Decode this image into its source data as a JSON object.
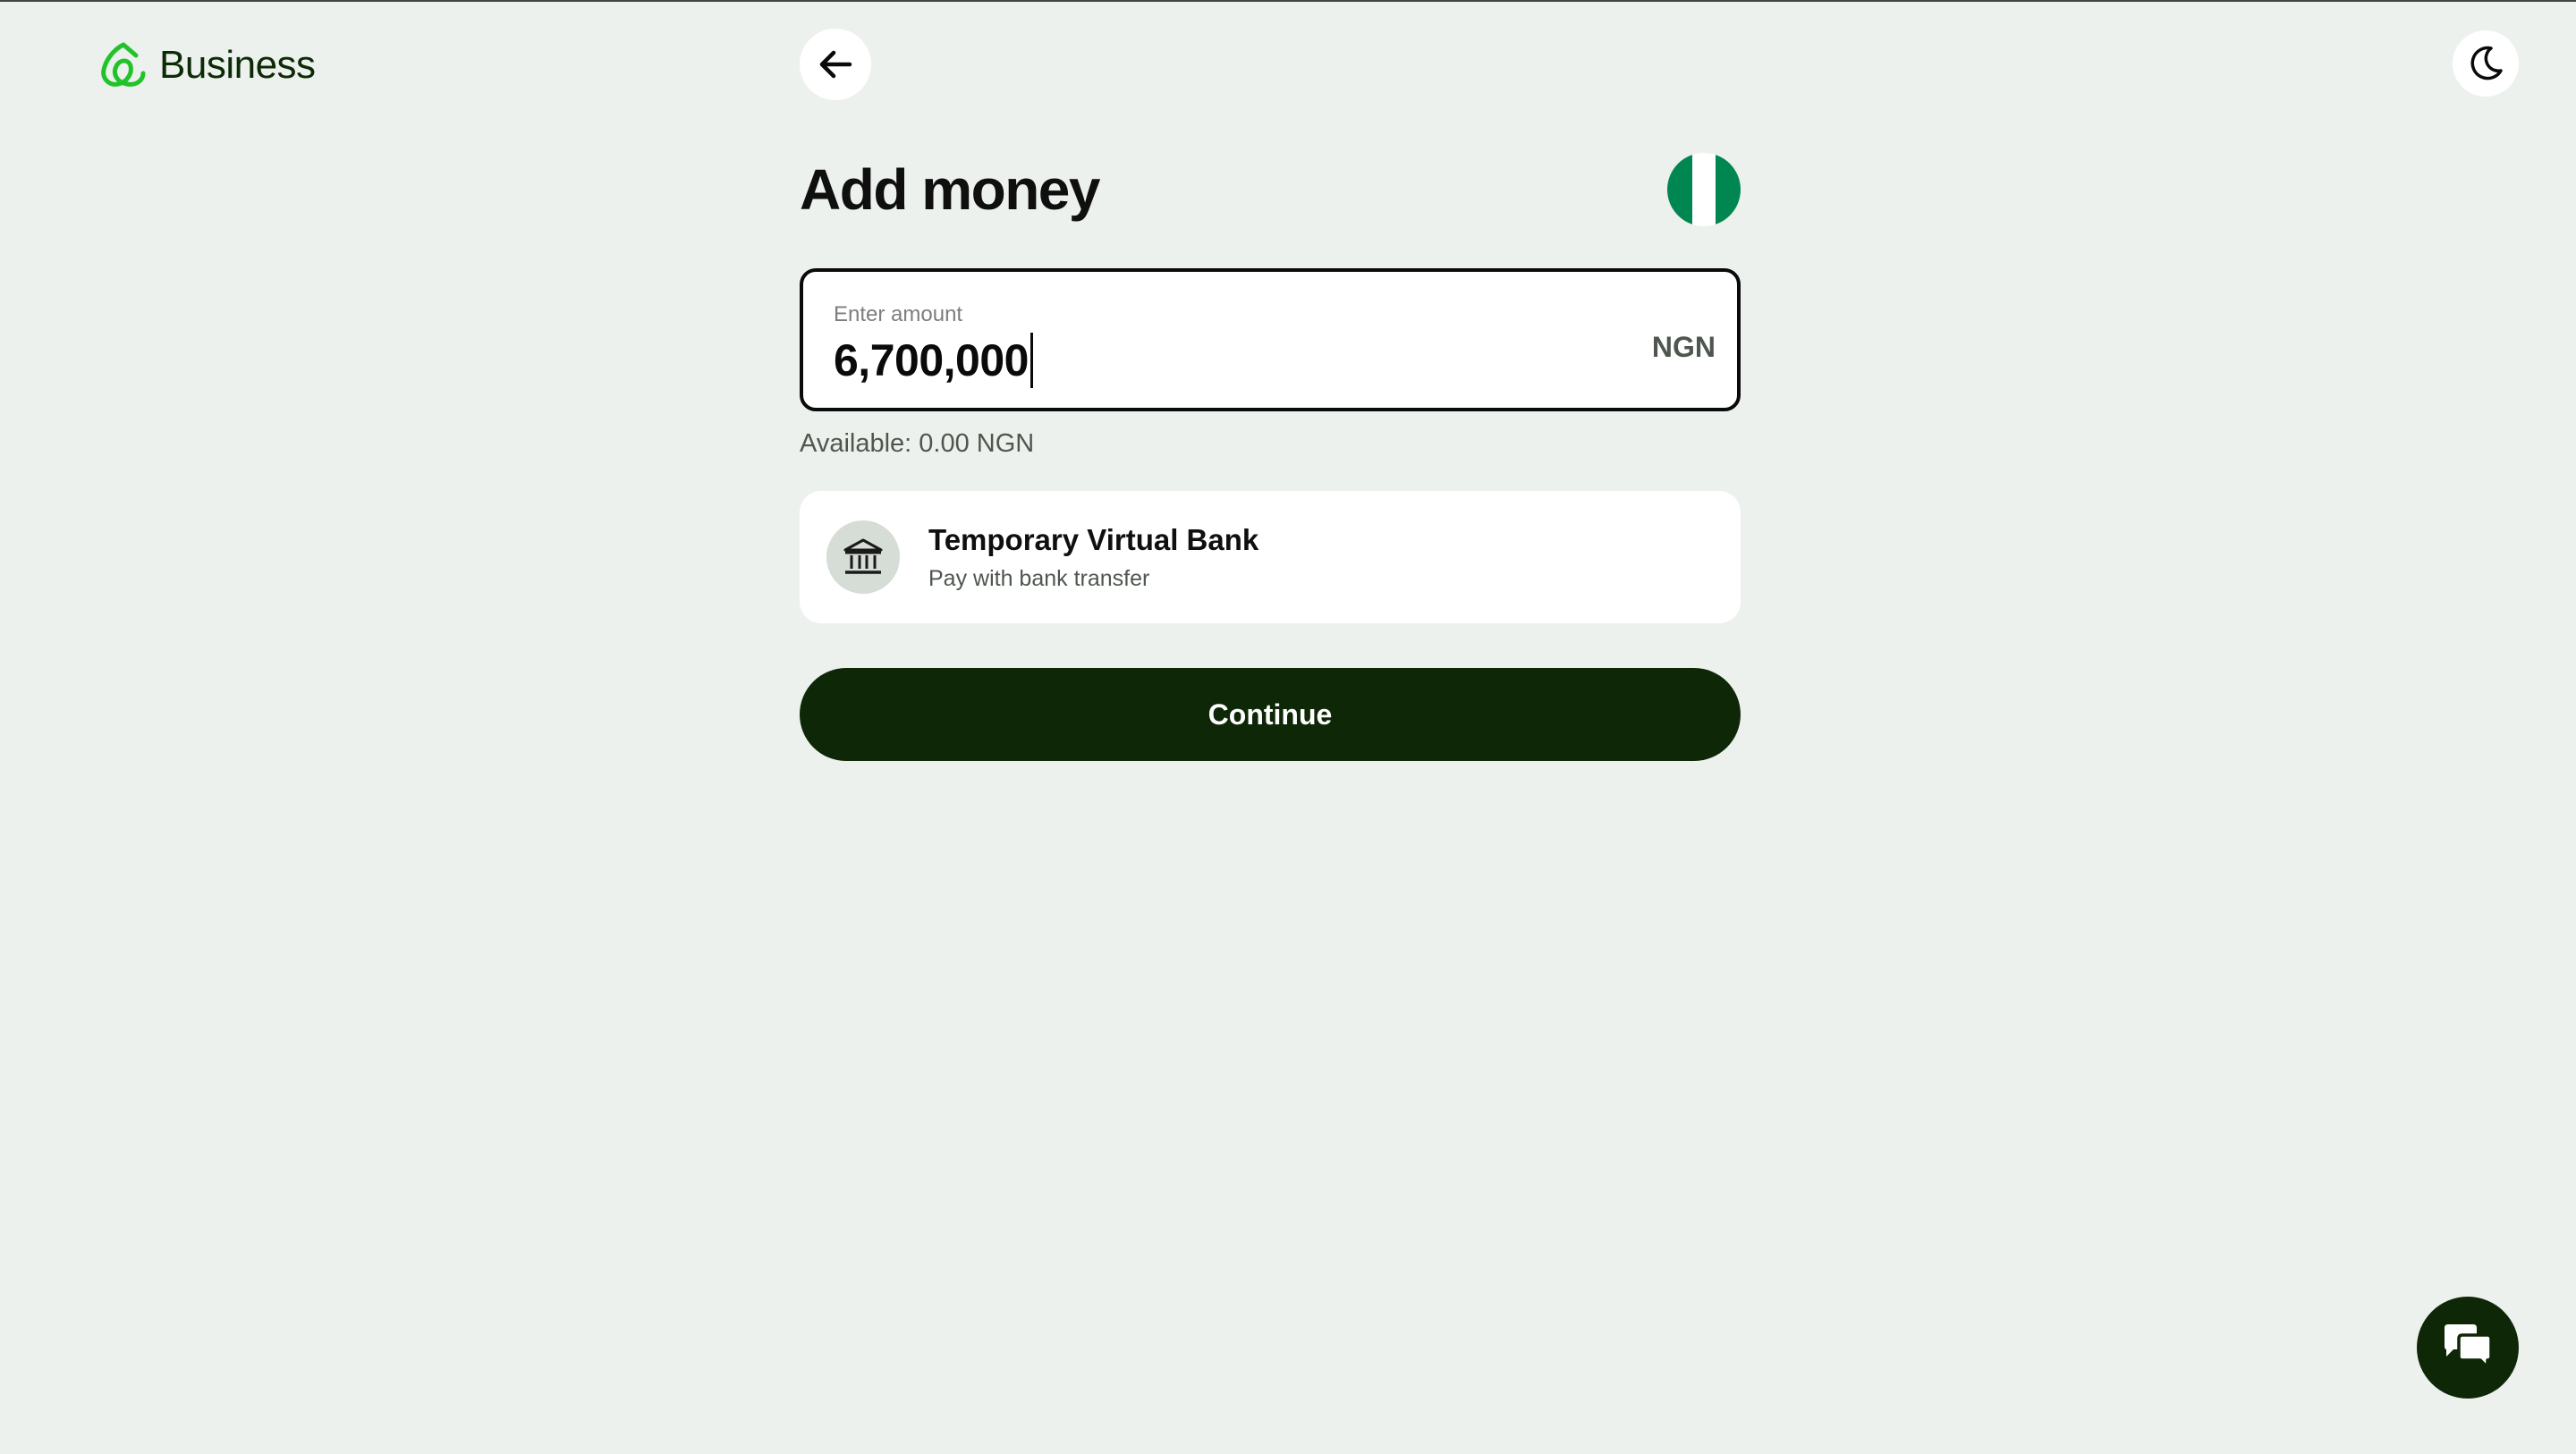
{
  "header": {
    "brand": "Business",
    "back_icon": "arrow-left-icon",
    "theme_icon": "moon-icon"
  },
  "main": {
    "title": "Add money",
    "flag": "nigeria-flag",
    "amount": {
      "label": "Enter amount",
      "value": "6,700,000",
      "currency": "NGN"
    },
    "available": "Available: 0.00 NGN",
    "method": {
      "icon": "bank-icon",
      "title": "Temporary Virtual Bank",
      "subtitle": "Pay with bank transfer"
    },
    "continue_label": "Continue"
  },
  "chat": {
    "icon": "chat-icon"
  },
  "colors": {
    "background": "#edf1ed",
    "brand_green": "#22c32a",
    "dark_green": "#0e2707",
    "flag_green": "#008751"
  }
}
